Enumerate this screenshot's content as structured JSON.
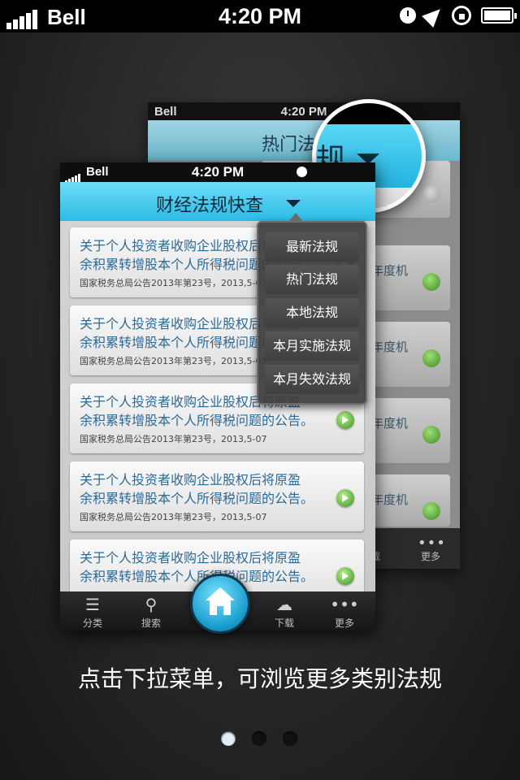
{
  "status_bar": {
    "carrier": "Bell",
    "time": "4:20 PM"
  },
  "back_screen": {
    "carrier": "Bell",
    "time": "4:20 PM",
    "header_partial": "热门法",
    "row_text_partial": "年度机",
    "tab_labels": [
      "载",
      "更多"
    ]
  },
  "magnifier": {
    "title_partial": "规"
  },
  "front_screen": {
    "carrier": "Bell",
    "time": "4:20 PM",
    "title": "财经法规快查",
    "items": [
      {
        "line1": "关于个人投资者收购企业股权后将原盈",
        "line2": "余积累转增股本个人所得税问题的公告。",
        "meta": "国家税务总局公告2013年第23号，2013,5-07"
      },
      {
        "line1": "关于个人投资者收购企业股权后将原盈",
        "line2": "余积累转增股本个人所得税问题的公告。",
        "meta": "国家税务总局公告2013年第23号，2013,5-07"
      },
      {
        "line1": "关于个人投资者收购企业股权后将原盈",
        "line2": "余积累转增股本个人所得税问题的公告。",
        "meta": "国家税务总局公告2013年第23号，2013,5-07"
      },
      {
        "line1": "关于个人投资者收购企业股权后将原盈",
        "line2": "余积累转增股本个人所得税问题的公告。",
        "meta": "国家税务总局公告2013年第23号，2013,5-07"
      },
      {
        "line1": "关于个人投资者收购企业股权后将原盈",
        "line2": "余积累转增股本个人所得税问题的公告。",
        "meta": ""
      }
    ],
    "tabs": {
      "category": "分类",
      "search": "搜索",
      "download": "下载",
      "more": "更多"
    },
    "dropdown": [
      "最新法规",
      "热门法规",
      "本地法规",
      "本月实施法规",
      "本月失效法规"
    ]
  },
  "caption": "点击下拉菜单，可浏览更多类别法规",
  "pager": {
    "count": 3,
    "active": 0
  },
  "colors": {
    "header_blue": "#2bbbe6",
    "link_blue": "#2d6a96",
    "go_green": "#3d8f1f"
  }
}
